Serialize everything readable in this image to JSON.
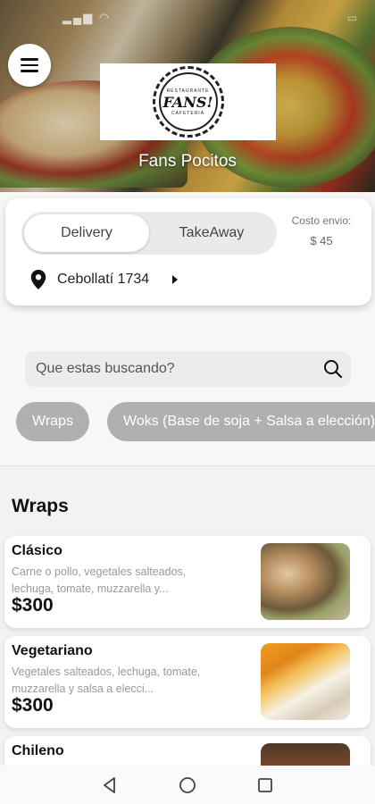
{
  "header": {
    "shop_name": "Fans Pocitos",
    "logo_text": "FANS!",
    "logo_top": "RESTAURANTE",
    "logo_bottom": "CAFETERIA"
  },
  "order": {
    "delivery_label": "Delivery",
    "takeaway_label": "TakeAway",
    "selected": "Delivery",
    "shipping_label": "Costo envio:",
    "shipping_value": "$ 45",
    "address": "Cebollatí 1734"
  },
  "search": {
    "placeholder": "Que estas buscando?"
  },
  "categories": [
    {
      "label": "Wraps"
    },
    {
      "label": "Woks (Base de soja + Salsa a elección)"
    }
  ],
  "section": {
    "title": "Wraps"
  },
  "products": [
    {
      "name": "Clásico",
      "description": "Carne o pollo, vegetales salteados, lechuga, tomate, muzzarella y...",
      "price": "$300"
    },
    {
      "name": "Vegetariano",
      "description": "Vegetales salteados, lechuga, tomate, muzzarella y salsa a elecci...",
      "price": "$300"
    },
    {
      "name": "Chileno",
      "description": "",
      "price": ""
    }
  ],
  "icons": {
    "menu": "hamburger-menu-icon",
    "location": "location-pin-icon",
    "search": "search-icon",
    "nav_back": "back-triangle-icon",
    "nav_home": "home-circle-icon",
    "nav_recent": "recent-square-icon"
  },
  "colors": {
    "chip_bg": "#b0b0b0",
    "card_bg": "#ffffff",
    "toggle_bg": "#eaeaea"
  }
}
